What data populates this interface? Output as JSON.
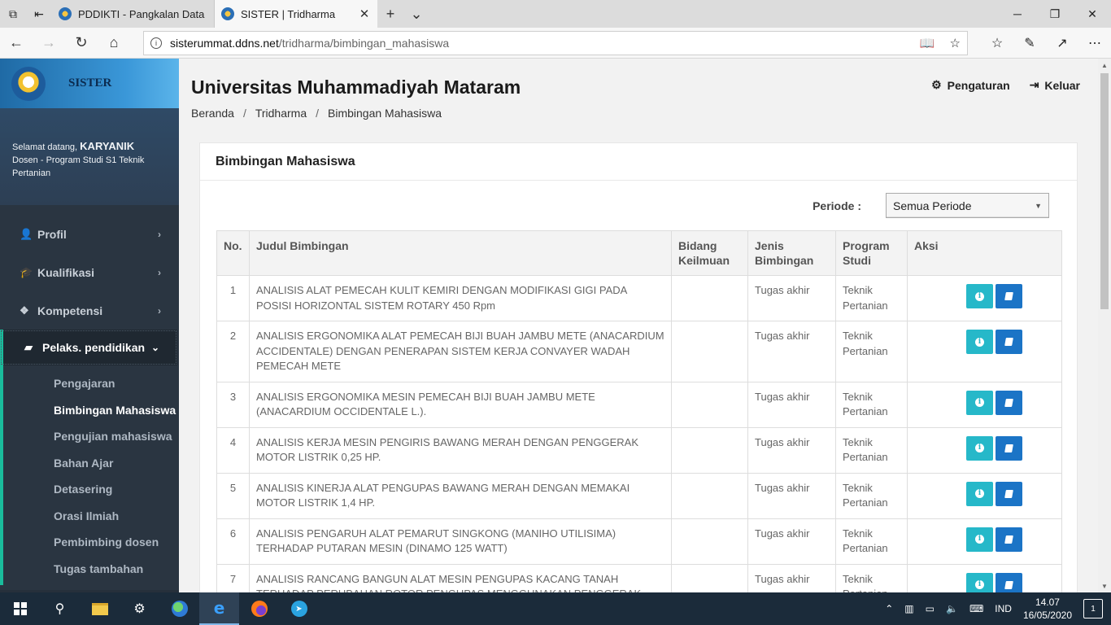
{
  "browser": {
    "tabs": [
      {
        "title": "PDDIKTI - Pangkalan Data P",
        "active": false
      },
      {
        "title": "SISTER | Tridharma",
        "active": true
      }
    ],
    "url_host": "sisterummat.ddns.net",
    "url_path": "/tridharma/bimbingan_mahasiswa"
  },
  "sidebar": {
    "brand": "SISTER",
    "welcome_prefix": "Selamat datang, ",
    "user_name": "KARYANIK",
    "user_role": "Dosen - Program Studi S1 Teknik Pertanian",
    "menu": [
      {
        "label": "Profil",
        "icon": "user-icon"
      },
      {
        "label": "Kualifikasi",
        "icon": "graduation-cap-icon"
      },
      {
        "label": "Kompetensi",
        "icon": "cubes-icon"
      },
      {
        "label": "Pelaks. pendidikan",
        "icon": "book-icon"
      }
    ],
    "submenu": [
      "Pengajaran",
      "Bimbingan Mahasiswa",
      "Pengujian mahasiswa",
      "Bahan Ajar",
      "Detasering",
      "Orasi Ilmiah",
      "Pembimbing dosen",
      "Tugas tambahan"
    ],
    "active_submenu": "Bimbingan Mahasiswa"
  },
  "header": {
    "title": "Universitas Muhammadiyah Mataram",
    "settings_label": "Pengaturan",
    "logout_label": "Keluar",
    "breadcrumb": [
      "Beranda",
      "Tridharma",
      "Bimbingan Mahasiswa"
    ]
  },
  "panel": {
    "title": "Bimbingan Mahasiswa",
    "filter_label": "Periode :",
    "filter_value": "Semua Periode"
  },
  "table": {
    "headers": [
      "No.",
      "Judul Bimbingan",
      "Bidang Keilmuan",
      "Jenis Bimbingan",
      "Program Studi",
      "Aksi"
    ],
    "rows": [
      {
        "no": "1",
        "judul": "ANALISIS ALAT PEMECAH KULIT KEMIRI DENGAN MODIFIKASI GIGI PADA POSISI HORIZONTAL SISTEM ROTARY 450 Rpm",
        "bidang": "",
        "jenis": "Tugas akhir",
        "prodi": "Teknik Pertanian"
      },
      {
        "no": "2",
        "judul": "ANALISIS ERGONOMIKA ALAT PEMECAH BIJI BUAH JAMBU METE (ANACARDIUM ACCIDENTALE) DENGAN PENERAPAN SISTEM KERJA CONVAYER WADAH PEMECAH METE",
        "bidang": "",
        "jenis": "Tugas akhir",
        "prodi": "Teknik Pertanian"
      },
      {
        "no": "3",
        "judul": "ANALISIS ERGONOMIKA MESIN PEMECAH BIJI BUAH JAMBU METE (ANACARDIUM OCCIDENTALE L.).",
        "bidang": "",
        "jenis": "Tugas akhir",
        "prodi": "Teknik Pertanian"
      },
      {
        "no": "4",
        "judul": "ANALISIS KERJA MESIN PENGIRIS BAWANG MERAH DENGAN PENGGERAK MOTOR LISTRIK 0,25 HP.",
        "bidang": "",
        "jenis": "Tugas akhir",
        "prodi": "Teknik Pertanian"
      },
      {
        "no": "5",
        "judul": "ANALISIS KINERJA ALAT PENGUPAS BAWANG MERAH DENGAN MEMAKAI MOTOR LISTRIK 1,4 HP.",
        "bidang": "",
        "jenis": "Tugas akhir",
        "prodi": "Teknik Pertanian"
      },
      {
        "no": "6",
        "judul": "ANALISIS PENGARUH ALAT PEMARUT SINGKONG (MANIHO UTILISIMA) TERHADAP PUTARAN MESIN (DINAMO 125 WATT)",
        "bidang": "",
        "jenis": "Tugas akhir",
        "prodi": "Teknik Pertanian"
      },
      {
        "no": "7",
        "judul": "ANALISIS RANCANG BANGUN ALAT MESIN PENGUPAS KACANG TANAH TERHADAP PERUBAHAN ROTOR PENGUPAS MENGGUNAKAN PENGGERAK",
        "bidang": "",
        "jenis": "Tugas akhir",
        "prodi": "Teknik Pertanian"
      }
    ]
  },
  "taskbar": {
    "language": "IND",
    "time": "14.07",
    "date": "16/05/2020",
    "notification_count": "1"
  },
  "colors": {
    "sidebar_bg": "#2a3541",
    "accent_teal": "#1abc9c",
    "btn_info": "#26b8c9",
    "btn_doc": "#1b74c6"
  }
}
